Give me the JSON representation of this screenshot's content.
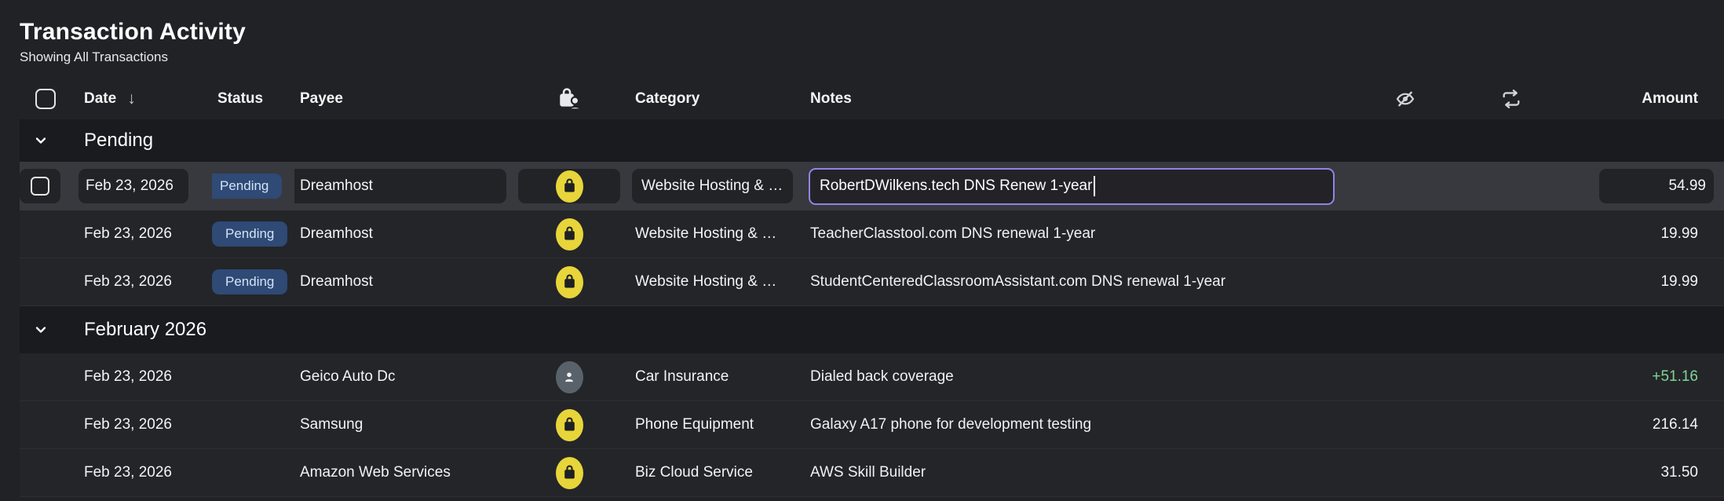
{
  "header": {
    "title": "Transaction Activity",
    "subtitle": "Showing All Transactions"
  },
  "columns": {
    "date": "Date",
    "status": "Status",
    "payee": "Payee",
    "category": "Category",
    "notes": "Notes",
    "amount": "Amount"
  },
  "icons": {
    "sort_desc": "arrow-down",
    "select_all": "checkbox",
    "merchant_column": "bag-person",
    "hidden_column": "eye-slash",
    "recurring_column": "repeat",
    "section_collapse": "chevron-down",
    "merchant_bag": "shopping-bag",
    "merchant_person": "person"
  },
  "colors": {
    "accent_purple": "#9283e8",
    "badge_bg": "#2e4a75",
    "badge_text": "#d3e2f6",
    "merchant_yellow": "#e8d53a",
    "avatar_gray": "#59626a",
    "amount_positive": "#7fd695"
  },
  "sort_glyph": "↓",
  "sections": [
    {
      "label": "Pending",
      "rows": [
        {
          "date": "Feb 23, 2026",
          "status": "Pending",
          "payee": "Dreamhost",
          "merchant_icon": "shopping-bag",
          "category": "Website Hosting & …",
          "notes": "RobertDWilkens.tech DNS Renew 1-year",
          "amount": "54.99",
          "editing": true,
          "selected": true
        },
        {
          "date": "Feb 23, 2026",
          "status": "Pending",
          "payee": "Dreamhost",
          "merchant_icon": "shopping-bag",
          "category": "Website Hosting & …",
          "notes": "TeacherClasstool.com DNS renewal 1-year",
          "amount": "19.99"
        },
        {
          "date": "Feb 23, 2026",
          "status": "Pending",
          "payee": "Dreamhost",
          "merchant_icon": "shopping-bag",
          "category": "Website Hosting & …",
          "notes": "StudentCenteredClassroomAssistant.com DNS renewal 1-year",
          "amount": "19.99"
        }
      ]
    },
    {
      "label": "February 2026",
      "rows": [
        {
          "date": "Feb 23, 2026",
          "status": "",
          "payee": "Geico Auto Dc",
          "merchant_icon": "person",
          "category": "Car Insurance",
          "notes": "Dialed back coverage",
          "amount": "+51.16",
          "amount_positive": true
        },
        {
          "date": "Feb 23, 2026",
          "status": "",
          "payee": "Samsung",
          "merchant_icon": "shopping-bag",
          "category": "Phone Equipment",
          "notes": "Galaxy A17 phone for development testing",
          "amount": "216.14"
        },
        {
          "date": "Feb 23, 2026",
          "status": "",
          "payee": "Amazon Web Services",
          "merchant_icon": "shopping-bag",
          "category": "Biz Cloud Service",
          "notes": "AWS Skill Builder",
          "amount": "31.50"
        }
      ]
    }
  ]
}
